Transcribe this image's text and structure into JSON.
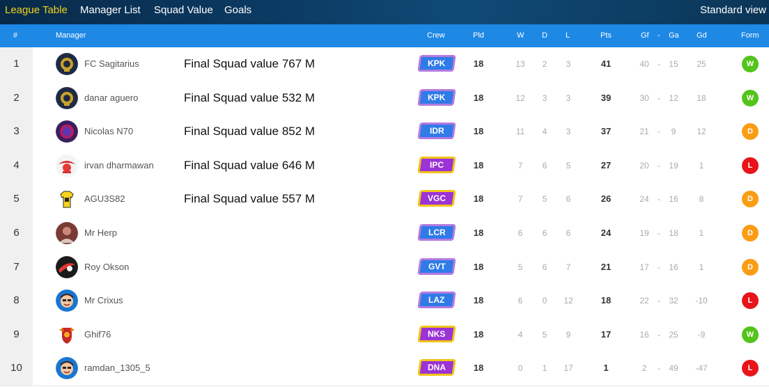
{
  "nav": {
    "tabs": [
      "League Table",
      "Manager List",
      "Squad Value",
      "Goals"
    ],
    "active": 0,
    "standard_view": "Standard view"
  },
  "headers": {
    "rank": "#",
    "manager": "Manager",
    "crew": "Crew",
    "pld": "Pld",
    "w": "W",
    "d": "D",
    "l": "L",
    "pts": "Pts",
    "gf": "Gf",
    "dash": "-",
    "ga": "Ga",
    "gd": "Gd",
    "form": "Form"
  },
  "colors": {
    "header_bg": "#1e88e5",
    "active_tab": "#f5d21a",
    "form_W": "#52c41a",
    "form_D": "#fa9d14",
    "form_L": "#e8141a",
    "crew_blue": "#2f7be8",
    "crew_purple": "#9b33d6"
  },
  "rows": [
    {
      "rank": "1",
      "manager": "FC Sagitarius",
      "avatar": "dark-crest",
      "squad_value": "Final Squad value 767 M",
      "crew": "KPK",
      "crew_style": "blue",
      "pld": "18",
      "w": "13",
      "d": "2",
      "l": "3",
      "pts": "41",
      "gf": "40",
      "dash": "-",
      "ga": "15",
      "gd": "25",
      "form": "W"
    },
    {
      "rank": "2",
      "manager": "danar aguero",
      "avatar": "dark-crest",
      "squad_value": "Final Squad value 532 M",
      "crew": "KPK",
      "crew_style": "blue",
      "pld": "18",
      "w": "12",
      "d": "3",
      "l": "3",
      "pts": "39",
      "gf": "30",
      "dash": "-",
      "ga": "12",
      "gd": "18",
      "form": "W"
    },
    {
      "rank": "3",
      "manager": "Nicolas N70",
      "avatar": "purple-emblem",
      "squad_value": "Final Squad value 852 M",
      "crew": "IDR",
      "crew_style": "blue",
      "pld": "18",
      "w": "11",
      "d": "4",
      "l": "3",
      "pts": "37",
      "gf": "21",
      "dash": "-",
      "ga": "9",
      "gd": "12",
      "form": "D"
    },
    {
      "rank": "4",
      "manager": "irvan dharmawan",
      "avatar": "red-white-logo",
      "squad_value": "Final Squad value 646 M",
      "crew": "IPC",
      "crew_style": "purple",
      "pld": "18",
      "w": "7",
      "d": "6",
      "l": "5",
      "pts": "27",
      "gf": "20",
      "dash": "-",
      "ga": "19",
      "gd": "1",
      "form": "L"
    },
    {
      "rank": "5",
      "manager": "AGU3S82",
      "avatar": "yellow-jersey",
      "squad_value": "Final Squad value 557 M",
      "crew": "VGC",
      "crew_style": "purple",
      "pld": "18",
      "w": "7",
      "d": "5",
      "l": "6",
      "pts": "26",
      "gf": "24",
      "dash": "-",
      "ga": "16",
      "gd": "8",
      "form": "D"
    },
    {
      "rank": "6",
      "manager": "Mr Herp",
      "avatar": "brown-photo",
      "squad_value": "",
      "crew": "LCR",
      "crew_style": "blue",
      "pld": "18",
      "w": "6",
      "d": "6",
      "l": "6",
      "pts": "24",
      "gf": "19",
      "dash": "-",
      "ga": "18",
      "gd": "1",
      "form": "D"
    },
    {
      "rank": "7",
      "manager": "Roy Okson",
      "avatar": "red-black-logo",
      "squad_value": "",
      "crew": "GVT",
      "crew_style": "blue",
      "pld": "18",
      "w": "5",
      "d": "6",
      "l": "7",
      "pts": "21",
      "gf": "17",
      "dash": "-",
      "ga": "16",
      "gd": "1",
      "form": "D"
    },
    {
      "rank": "8",
      "manager": "Mr Crixus",
      "avatar": "cartoon-face",
      "squad_value": "",
      "crew": "LAZ",
      "crew_style": "blue",
      "pld": "18",
      "w": "6",
      "d": "0",
      "l": "12",
      "pts": "18",
      "gf": "22",
      "dash": "-",
      "ga": "32",
      "gd": "-10",
      "form": "L"
    },
    {
      "rank": "9",
      "manager": "Ghif76",
      "avatar": "shield-crest",
      "squad_value": "",
      "crew": "NKS",
      "crew_style": "purple",
      "pld": "18",
      "w": "4",
      "d": "5",
      "l": "9",
      "pts": "17",
      "gf": "16",
      "dash": "-",
      "ga": "25",
      "gd": "-9",
      "form": "W"
    },
    {
      "rank": "10",
      "manager": "ramdan_1305_5",
      "avatar": "cartoon-face",
      "squad_value": "",
      "crew": "DNA",
      "crew_style": "purple",
      "pld": "18",
      "w": "0",
      "d": "1",
      "l": "17",
      "pts": "1",
      "gf": "2",
      "dash": "-",
      "ga": "49",
      "gd": "-47",
      "form": "L"
    }
  ]
}
